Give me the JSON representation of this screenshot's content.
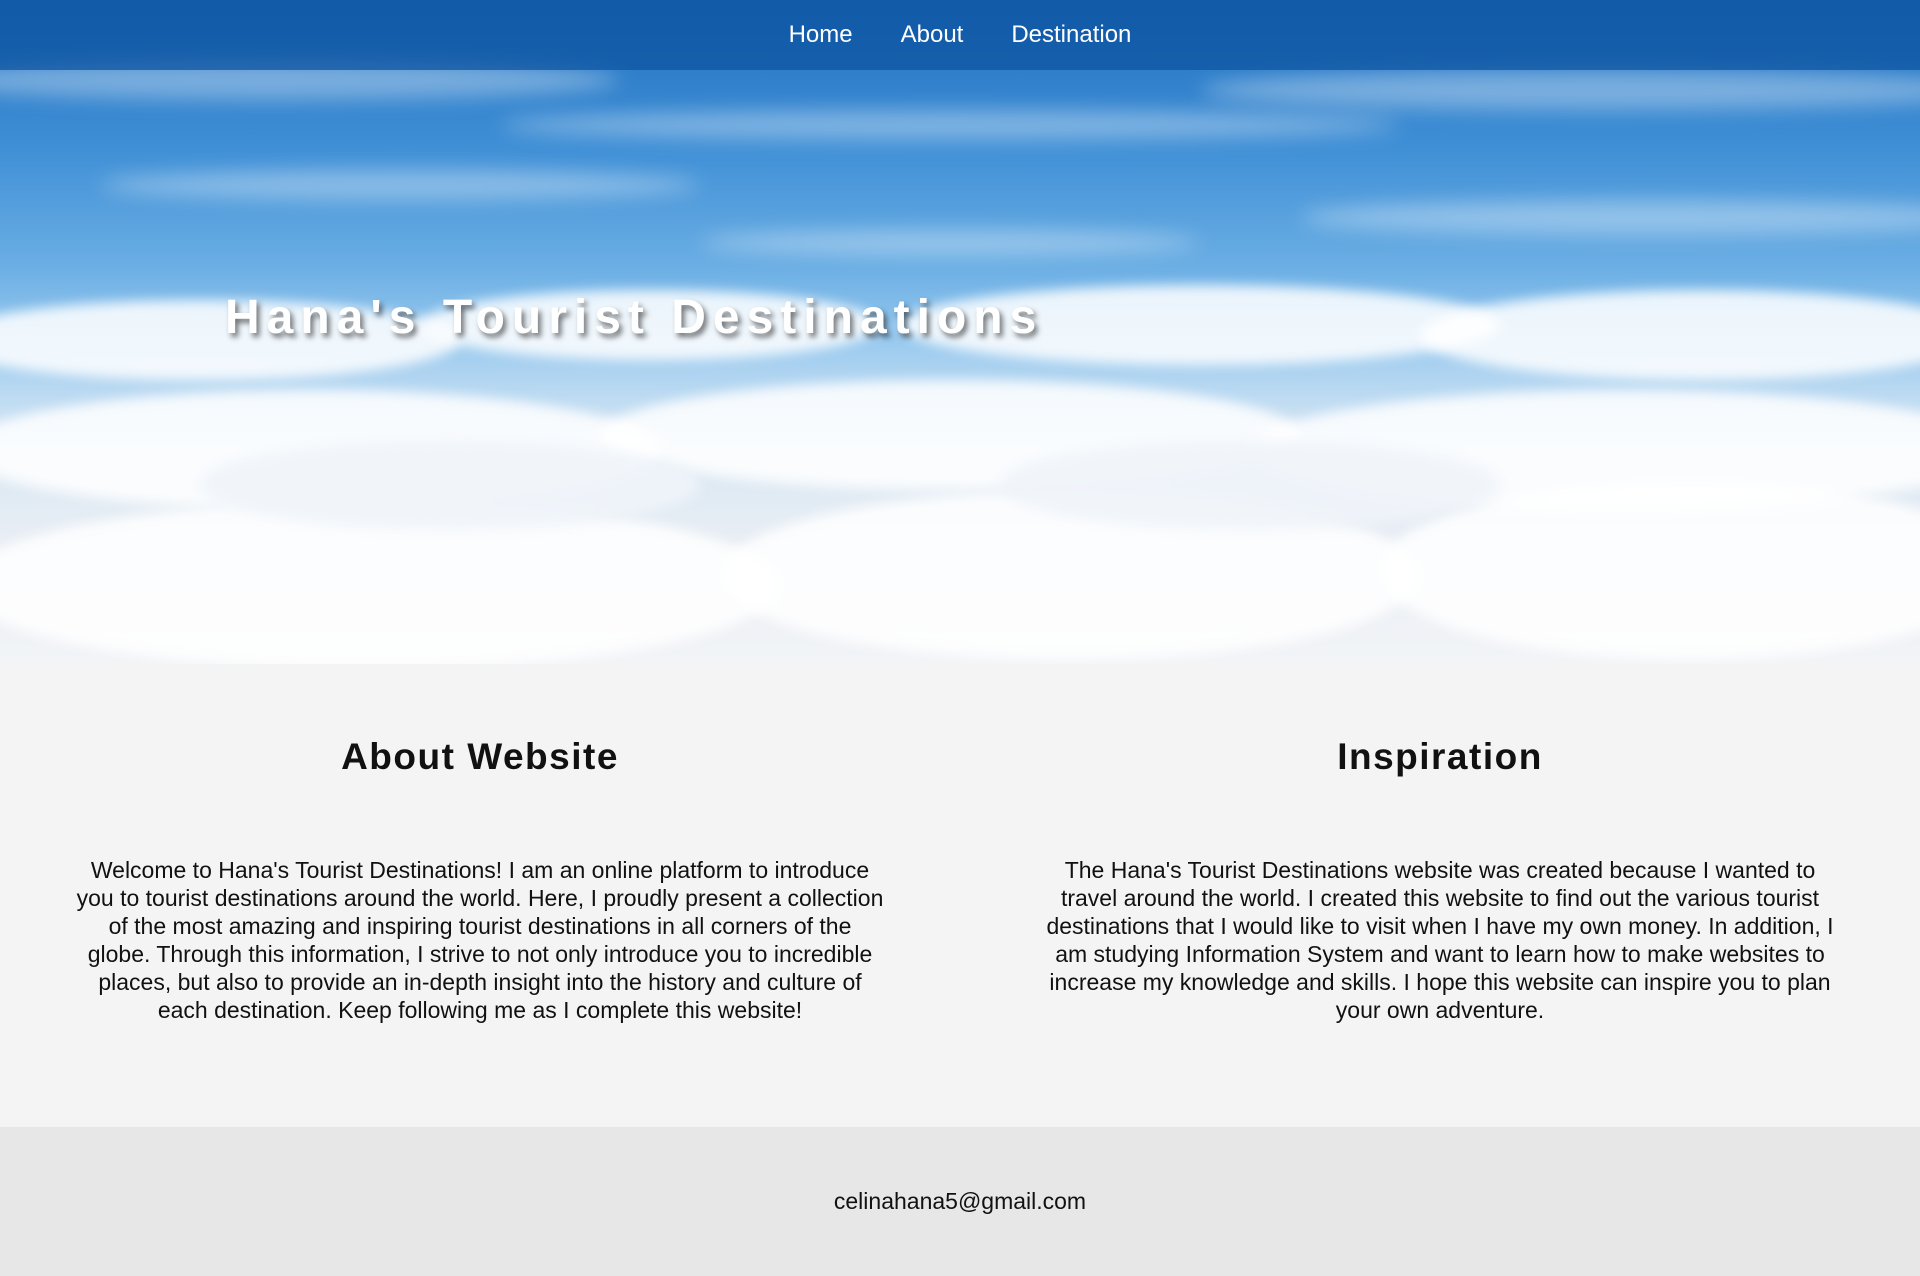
{
  "nav": {
    "items": [
      {
        "label": "Home"
      },
      {
        "label": "About"
      },
      {
        "label": "Destination"
      }
    ]
  },
  "hero": {
    "title": "Hana's Tourist Destinations"
  },
  "sections": {
    "about": {
      "heading": "About Website",
      "body": "Welcome to Hana's Tourist Destinations! I am an online platform to introduce you to tourist destinations around the world. Here, I proudly present a collection of the most amazing and inspiring tourist destinations in all corners of the globe. Through this information, I strive to not only introduce you to incredible places, but also to provide an in-depth insight into the history and culture of each destination. Keep following me as I complete this website!"
    },
    "inspiration": {
      "heading": "Inspiration",
      "body": "The Hana's Tourist Destinations website was created because I wanted to travel around the world. I created this website to find out the various tourist destinations that I would like to visit when I have my own money. In addition, I am studying Information System and want to learn how to make websites to increase my knowledge and skills. I hope this website can inspire you to plan your own adventure."
    }
  },
  "footer": {
    "email": "celinahana5@gmail.com"
  },
  "colors": {
    "nav_bg": "#0e54a0",
    "content_bg": "#f4f4f4",
    "footer_bg": "#e7e7e7"
  }
}
